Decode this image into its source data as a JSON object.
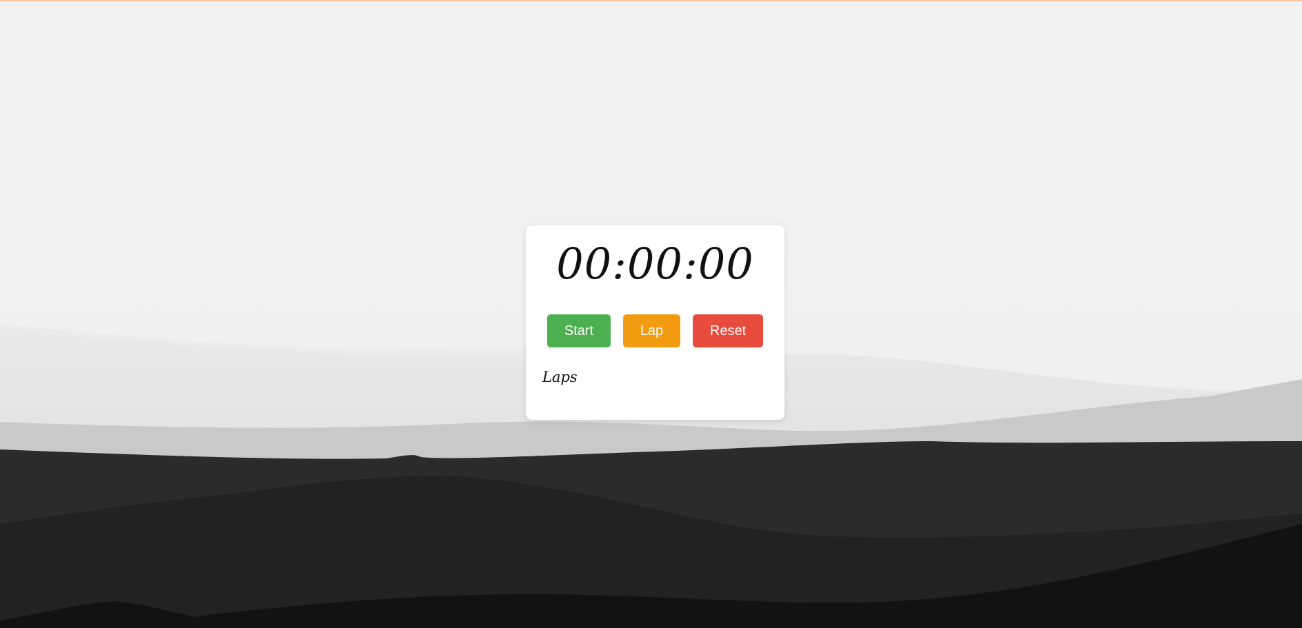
{
  "stopwatch": {
    "time": "00:00:00",
    "buttons": {
      "start": "Start",
      "lap": "Lap",
      "reset": "Reset"
    },
    "laps_heading": "Laps",
    "laps": []
  },
  "colors": {
    "start": "#4caf50",
    "lap": "#f39c12",
    "reset": "#e74c3c",
    "card": "#ffffff",
    "accent_line": "#f6c9a3"
  }
}
